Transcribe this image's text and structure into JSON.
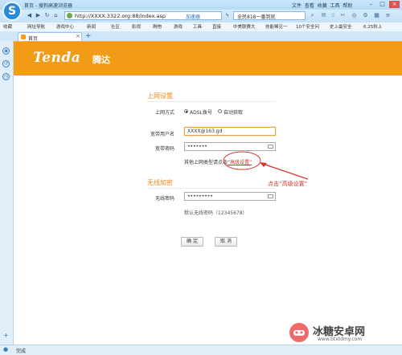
{
  "browser": {
    "window_title": "首页 - 搜狗高速浏览器",
    "menu": [
      "文件",
      "查看",
      "收藏",
      "工具",
      "帮助"
    ],
    "url": "http://XXXX.3322.org:88/index.asp",
    "speed_mode": "加速器",
    "search_text": "全民818一番到底",
    "bookmarks": [
      "收藏",
      "网址导航",
      "游戏中心",
      "新闻",
      "社区",
      "影视",
      "购物",
      "游戏",
      "工具",
      "直接",
      "中美联赛大",
      "技能稀见一",
      "10个安全问",
      "史上最安全",
      "6.25秋上"
    ],
    "tab_title": "首页",
    "status_text": "完成"
  },
  "router": {
    "brand": "Tenda",
    "brand_cn": "腾达",
    "internet_section": "上网设置",
    "mode_label": "上网方式",
    "mode_options": [
      "ADSL拨号",
      "自动获取"
    ],
    "username_label": "宽带用户名",
    "username_value": "XXXX@163.gd",
    "password_label": "宽带密码",
    "password_value": "•••••••",
    "other_hint_prefix": "其他上网类型请点击",
    "advanced_link": "“高级设置”",
    "wireless_section": "无线加密",
    "wifi_password_label": "无线密码",
    "wifi_password_value": "•••••••••",
    "default_wifi_hint": "默认无线密码（12345678）",
    "ok_button": "确 定",
    "cancel_button": "取 消"
  },
  "annotation": {
    "note": "点击“高级设置”",
    "highlight_color": "#d9342b"
  },
  "watermark": {
    "title": "冰糖安卓网",
    "url": "www.btxtdmy.com"
  },
  "colors": {
    "banner": "#f29b16",
    "section_title": "#e8891c",
    "annotation": "#d9342b"
  }
}
